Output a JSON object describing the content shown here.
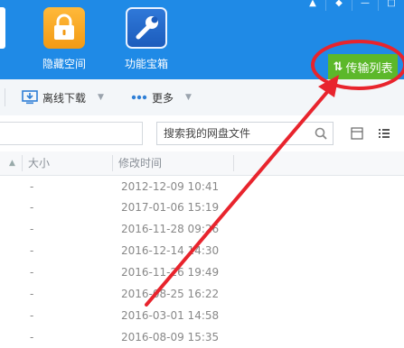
{
  "window": {
    "controls": [
      "▲",
      "◆",
      "—",
      "□"
    ]
  },
  "tiles": [
    {
      "label": "隐藏空间",
      "icon": "lock-icon"
    },
    {
      "label": "功能宝箱",
      "icon": "wrench-icon"
    }
  ],
  "transfer": {
    "label": "传输列表",
    "icon": "transfer-arrows-icon"
  },
  "toolbar": {
    "offline_download": "离线下载",
    "more": "更多"
  },
  "search": {
    "placeholder": "搜索我的网盘文件"
  },
  "table": {
    "headers": {
      "size": "大小",
      "modified": "修改时间"
    },
    "rows": [
      {
        "size": "-",
        "modified": "2012-12-09 10:41"
      },
      {
        "size": "-",
        "modified": "2017-01-06 15:19"
      },
      {
        "size": "-",
        "modified": "2016-11-28 09:26"
      },
      {
        "size": "-",
        "modified": "2016-12-14 14:30"
      },
      {
        "size": "-",
        "modified": "2016-11-26 19:49"
      },
      {
        "size": "-",
        "modified": "2016-08-25 16:22"
      },
      {
        "size": "-",
        "modified": "2016-03-01 14:58"
      },
      {
        "size": "-",
        "modified": "2016-08-09 15:35"
      }
    ]
  },
  "colors": {
    "topbar": "#1f8ae6",
    "transfer_button": "#5cb82a",
    "annotation": "#e8242d"
  }
}
